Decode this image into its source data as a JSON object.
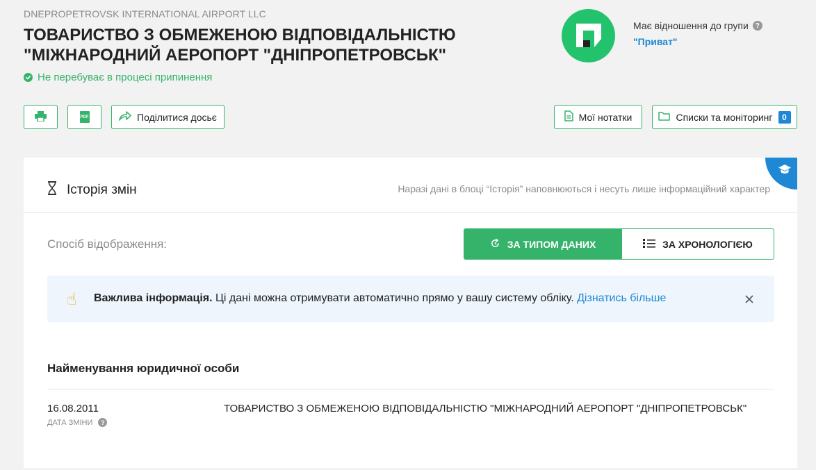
{
  "header": {
    "subtitle_en": "DNEPROPETROVSK INTERNATIONAL AIRPORT LLC",
    "title_line1": "ТОВАРИСТВО З ОБМЕЖЕНОЮ ВІДПОВІДАЛЬНІСТЮ",
    "title_line2": "\"МІЖНАРОДНИЙ АЕРОПОРТ \"ДНІПРОПЕТРОВСЬК\"",
    "status": "Не перебуває в процесі припинення",
    "group_label": "Має відношення до групи",
    "group_link": "\"Приват\""
  },
  "toolbar": {
    "print_icon": "printer-icon",
    "pdf_label": "PDF",
    "share_label": "Поділитися досьє",
    "notes_label": "Мої нотатки",
    "lists_label": "Списки та моніторинг",
    "lists_count": "0"
  },
  "history": {
    "title": "Історія змін",
    "note": "Наразі дані в блоці “Історія” наповнюються і несуть лише інформаційний характер",
    "display_label": "Спосіб відображення:",
    "by_type": "ЗА ТИПОМ ДАНИХ",
    "by_chronology": "ЗА ХРОНОЛОГІЄЮ",
    "info_bold": "Важлива інформація.",
    "info_text": " Ці дані можна отримувати автоматично прямо у вашу систему обліку. ",
    "info_link": "Дізнатись більше",
    "section_title": "Найменування юридичної особи",
    "rows": [
      {
        "date": "16.08.2011",
        "date_label": "Дата зміни",
        "value": "ТОВАРИСТВО З ОБМЕЖЕНОЮ ВІДПОВІДАЛЬНІСТЮ \"МІЖНАРОДНИЙ АЕРОПОРТ \"ДНІПРОПЕТРОВСЬК\""
      }
    ]
  },
  "colors": {
    "accent_green": "#36b36a",
    "logo_green": "#23c36d",
    "link_blue": "#1e88d4",
    "info_bg": "#eef5fc"
  },
  "icons": [
    "check-icon",
    "help-icon",
    "printer-icon",
    "pdf-icon",
    "share-icon",
    "notes-icon",
    "folder-icon",
    "hourglass-icon",
    "graduation-cap-icon",
    "refresh-icon",
    "list-icon",
    "hand-pointing-icon",
    "close-icon"
  ]
}
